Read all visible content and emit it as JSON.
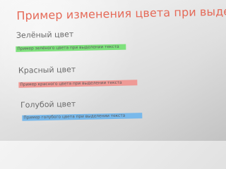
{
  "document": {
    "title": "Пример изменения цвета при выделении",
    "sections": [
      {
        "heading": "Зелёный цвет",
        "sample": "Пример зелёного цвета при выделении текста",
        "accent": "#7ee17c"
      },
      {
        "heading": "Красный цвет",
        "sample": "Пример красного цвета при выделении текста",
        "accent": "#ef9a96"
      },
      {
        "heading": "Голубой цвет",
        "sample": "Пример голубого цвета при выделении текста",
        "accent": "#79b9eb"
      }
    ]
  },
  "colors": {
    "title": "#e56a58",
    "background": "#ececec",
    "text": "#5a5a5a"
  }
}
